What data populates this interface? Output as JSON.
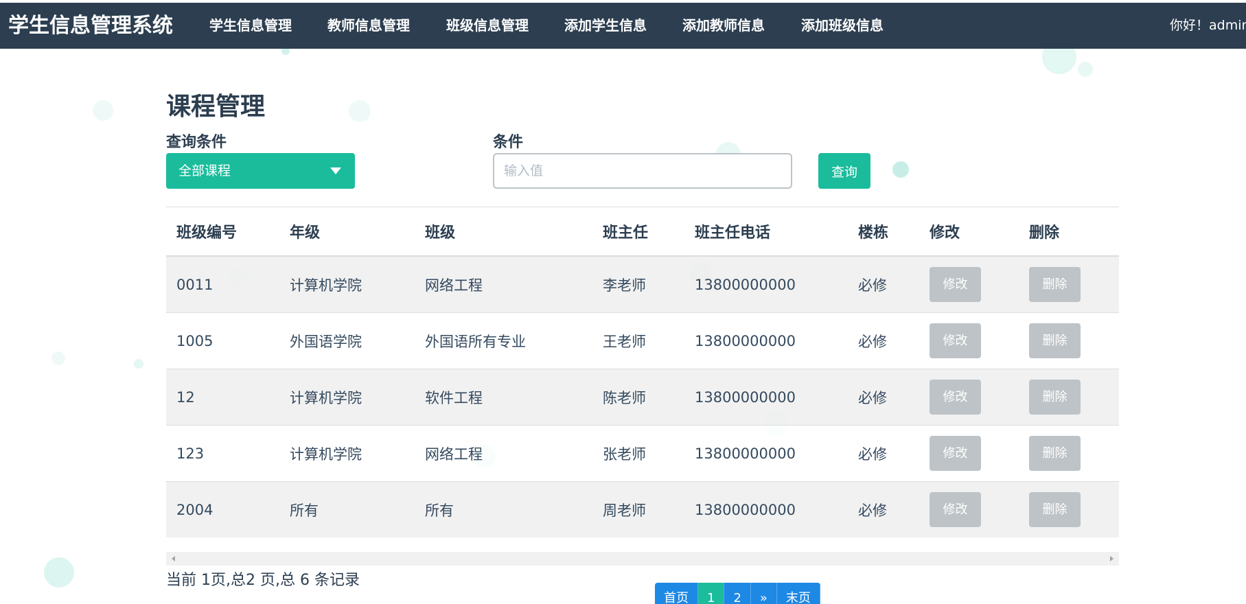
{
  "navbar": {
    "brand": "学生信息管理系统",
    "items": [
      {
        "label": "学生信息管理"
      },
      {
        "label": "教师信息管理"
      },
      {
        "label": "班级信息管理"
      },
      {
        "label": "添加学生信息"
      },
      {
        "label": "添加教师信息"
      },
      {
        "label": "添加班级信息"
      }
    ],
    "greeting": "你好！admin"
  },
  "main": {
    "title": "课程管理",
    "filter_label": "查询条件",
    "filter_select": {
      "selected": "全部课程"
    },
    "condition_label": "条件",
    "condition_input": {
      "value": "",
      "placeholder": "输入值"
    },
    "search_button": "查询"
  },
  "table": {
    "columns": [
      "班级编号",
      "年级",
      "班级",
      "班主任",
      "班主任电话",
      "楼栋",
      "修改",
      "删除"
    ],
    "rows": [
      {
        "id": "0011",
        "grade": "计算机学院",
        "class": "网络工程",
        "teacher": "李老师",
        "phone": "13800000000",
        "building": "必修",
        "edit": "修改",
        "delete": "删除"
      },
      {
        "id": "1005",
        "grade": "外国语学院",
        "class": "外国语所有专业",
        "teacher": "王老师",
        "phone": "13800000000",
        "building": "必修",
        "edit": "修改",
        "delete": "删除"
      },
      {
        "id": "12",
        "grade": "计算机学院",
        "class": "软件工程",
        "teacher": "陈老师",
        "phone": "13800000000",
        "building": "必修",
        "edit": "修改",
        "delete": "删除"
      },
      {
        "id": "123",
        "grade": "计算机学院",
        "class": "网络工程",
        "teacher": "张老师",
        "phone": "13800000000",
        "building": "必修",
        "edit": "修改",
        "delete": "删除"
      },
      {
        "id": "2004",
        "grade": "所有",
        "class": "所有",
        "teacher": "周老师",
        "phone": "13800000000",
        "building": "必修",
        "edit": "修改",
        "delete": "删除"
      }
    ]
  },
  "pagination": {
    "info": "当前 1页,总2 页,总 6 条记录",
    "buttons": [
      {
        "label": "首页",
        "active": false
      },
      {
        "label": "1",
        "active": true
      },
      {
        "label": "2",
        "active": false
      },
      {
        "label": "»",
        "active": false
      },
      {
        "label": "末页",
        "active": false
      }
    ]
  },
  "colors": {
    "navbar": "#2c3e50",
    "accent": "#1abc9c",
    "pagination": "#1e88e5",
    "disabled_button": "#bdc3c7"
  },
  "icons": {
    "select_caret": "caret-down-icon",
    "scroll_left": "scroll-left-arrow-icon",
    "scroll_right": "scroll-right-arrow-icon"
  }
}
